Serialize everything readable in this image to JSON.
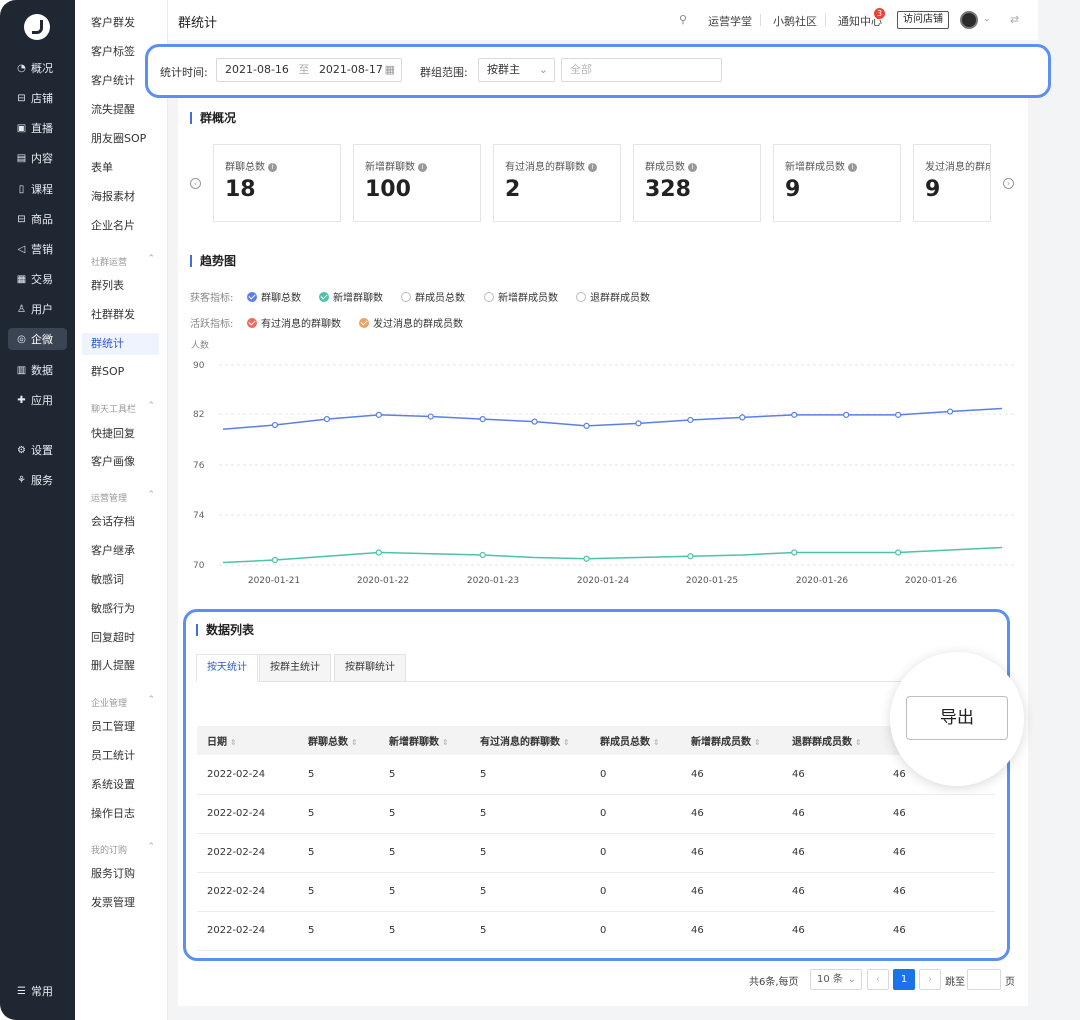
{
  "left_nav": {
    "items": [
      {
        "icon": "pie-chart-icon",
        "glyph": "◔",
        "label": "概况"
      },
      {
        "icon": "store-icon",
        "glyph": "⊟",
        "label": "店铺"
      },
      {
        "icon": "live-icon",
        "glyph": "▣",
        "label": "直播"
      },
      {
        "icon": "content-icon",
        "glyph": "▤",
        "label": "内容"
      },
      {
        "icon": "course-icon",
        "glyph": "▯",
        "label": "课程"
      },
      {
        "icon": "goods-icon",
        "glyph": "⊟",
        "label": "商品"
      },
      {
        "icon": "megaphone-icon",
        "glyph": "◁",
        "label": "营销"
      },
      {
        "icon": "trade-icon",
        "glyph": "▦",
        "label": "交易"
      },
      {
        "icon": "user-icon",
        "glyph": "♙",
        "label": "用户"
      },
      {
        "icon": "wecom-icon",
        "glyph": "◎",
        "label": "企微"
      },
      {
        "icon": "data-icon",
        "glyph": "▥",
        "label": "数据"
      },
      {
        "icon": "apps-icon",
        "glyph": "✚",
        "label": "应用"
      },
      {
        "icon": "settings-icon",
        "glyph": "⚙",
        "label": "设置"
      },
      {
        "icon": "service-icon",
        "glyph": "⚘",
        "label": "服务"
      }
    ],
    "bottom": {
      "icon": "menu-icon",
      "glyph": "☰",
      "label": "常用"
    }
  },
  "sub_nav": {
    "top_items": [
      "客户群发",
      "客户标签",
      "客户统计",
      "流失提醒",
      "朋友圈SOP",
      "表单",
      "海报素材",
      "企业名片"
    ],
    "groups": [
      {
        "title": "社群运营",
        "items": [
          "群列表",
          "社群群发",
          "群统计",
          "群SOP"
        ]
      },
      {
        "title": "聊天工具栏",
        "items": [
          "快捷回复",
          "客户画像"
        ]
      },
      {
        "title": "运营管理",
        "items": [
          "会话存档",
          "客户继承",
          "敏感词",
          "敏感行为",
          "回复超时",
          "删人提醒"
        ]
      },
      {
        "title": "企业管理",
        "items": [
          "员工管理",
          "员工统计",
          "系统设置",
          "操作日志"
        ]
      },
      {
        "title": "我的订购",
        "items": [
          "服务订购",
          "发票管理"
        ]
      }
    ]
  },
  "topbar": {
    "title": "群统计",
    "links": [
      "运营学堂",
      "小鹅社区",
      "通知中心"
    ],
    "notification_count": "3",
    "visit_store": "访问店铺"
  },
  "filter": {
    "time_label": "统计时间:",
    "start_date": "2021-08-16",
    "to": "至",
    "end_date": "2021-08-17",
    "scope_label": "群组范围:",
    "scope_value": "按群主",
    "scope_placeholder": "全部"
  },
  "overview": {
    "title": "群概况",
    "cards": [
      {
        "label": "群聊总数",
        "value": "18"
      },
      {
        "label": "新增群聊数",
        "value": "100"
      },
      {
        "label": "有过消息的群聊数",
        "value": "2"
      },
      {
        "label": "群成员数",
        "value": "328"
      },
      {
        "label": "新增群成员数",
        "value": "9"
      },
      {
        "label": "发过消息的群成",
        "value": "9"
      }
    ]
  },
  "trend": {
    "title": "趋势图",
    "acquire_label": "获客指标:",
    "acquire_metrics": [
      {
        "label": "群聊总数",
        "checked": true,
        "color": "#5b7ee8"
      },
      {
        "label": "新增群聊数",
        "checked": true,
        "color": "#4cc3a8"
      },
      {
        "label": "群成员总数",
        "checked": false,
        "color": "#bbbbbb"
      },
      {
        "label": "新增群成员数",
        "checked": false,
        "color": "#bbbbbb"
      },
      {
        "label": "退群群成员数",
        "checked": false,
        "color": "#bbbbbb"
      }
    ],
    "active_label": "活跃指标:",
    "active_metrics": [
      {
        "label": "有过消息的群聊数",
        "checked": true,
        "color": "#ec6a5e"
      },
      {
        "label": "发过消息的群成员数",
        "checked": true,
        "color": "#f0a060"
      }
    ]
  },
  "chart_data": {
    "type": "line",
    "ylabel": "人数",
    "y_ticks": [
      90,
      82,
      76,
      74,
      70
    ],
    "x_ticks": [
      "2020-01-21",
      "2020-01-22",
      "2020-01-23",
      "2020-01-24",
      "2020-01-25",
      "2020-01-26",
      "2020-01-26"
    ],
    "series": [
      {
        "name": "群聊总数",
        "color": "#5b7ee8",
        "values": [
          80.2,
          80.7,
          81.4,
          81.9,
          81.7,
          81.4,
          81.1,
          80.6,
          80.9,
          81.3,
          81.6,
          81.9,
          81.9,
          81.9,
          82.4,
          82.9
        ]
      },
      {
        "name": "新增群聊数",
        "color": "#4cc3a8",
        "values": [
          70.2,
          70.4,
          70.7,
          71.0,
          70.9,
          70.8,
          70.6,
          70.5,
          70.6,
          70.7,
          70.8,
          71.0,
          71.0,
          71.0,
          71.2,
          71.4
        ]
      }
    ]
  },
  "data_list": {
    "title": "数据列表",
    "tabs": [
      "按天统计",
      "按群主统计",
      "按群聊统计"
    ],
    "export_label": "导出",
    "columns": [
      "日期",
      "群聊总数",
      "新增群聊数",
      "有过消息的群聊数",
      "群成员总数",
      "新增群成员数",
      "退群群成员数",
      ""
    ],
    "rows": [
      [
        "2022-02-24",
        "5",
        "5",
        "5",
        "0",
        "46",
        "46",
        "46"
      ],
      [
        "2022-02-24",
        "5",
        "5",
        "5",
        "0",
        "46",
        "46",
        "46"
      ],
      [
        "2022-02-24",
        "5",
        "5",
        "5",
        "0",
        "46",
        "46",
        "46"
      ],
      [
        "2022-02-24",
        "5",
        "5",
        "5",
        "0",
        "46",
        "46",
        "46"
      ],
      [
        "2022-02-24",
        "5",
        "5",
        "5",
        "0",
        "46",
        "46",
        "46"
      ]
    ]
  },
  "pagination": {
    "total": "共6条,每页",
    "page_size": "10 条",
    "current_page": "1",
    "goto_label": "跳至",
    "page_unit": "页"
  }
}
